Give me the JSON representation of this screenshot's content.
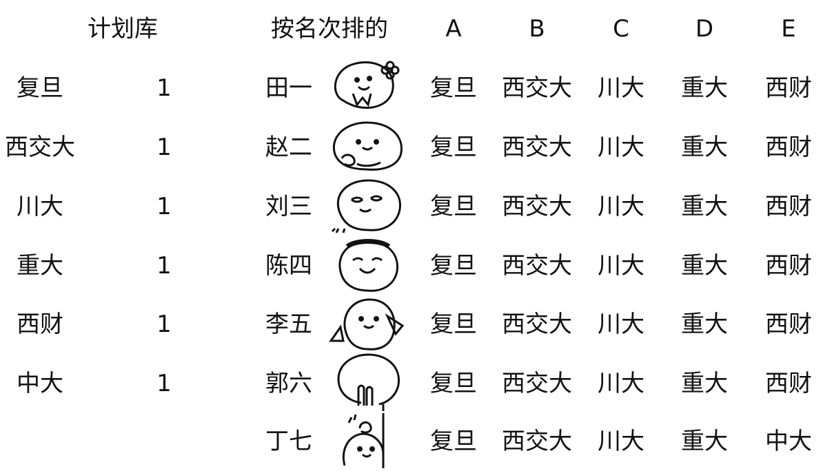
{
  "plan": {
    "header": "计划库",
    "schools": [
      "复旦",
      "西交大",
      "川大",
      "重大",
      "西财",
      "中大"
    ],
    "quotas": [
      "1",
      "1",
      "1",
      "1",
      "1",
      "1"
    ]
  },
  "ranking": {
    "header": "按名次排的",
    "choice_headers": [
      "A",
      "B",
      "C",
      "D",
      "E"
    ],
    "students": [
      {
        "name": "田一",
        "avatar": "smiley-flower-icon",
        "choices": [
          "复旦",
          "西交大",
          "川大",
          "重大",
          "西财"
        ]
      },
      {
        "name": "赵二",
        "avatar": "smiley-hands-icon",
        "choices": [
          "复旦",
          "西交大",
          "川大",
          "重大",
          "西财"
        ]
      },
      {
        "name": "刘三",
        "avatar": "smiley-smug-icon",
        "choices": [
          "复旦",
          "西交大",
          "川大",
          "重大",
          "西财"
        ]
      },
      {
        "name": "陈四",
        "avatar": "smiley-laughing-icon",
        "choices": [
          "复旦",
          "西交大",
          "川大",
          "重大",
          "西财"
        ]
      },
      {
        "name": "李五",
        "avatar": "smiley-waving-icon",
        "choices": [
          "复旦",
          "西交大",
          "川大",
          "重大",
          "西财"
        ]
      },
      {
        "name": "郭六",
        "avatar": "smiley-peace-icon",
        "choices": [
          "复旦",
          "西交大",
          "川大",
          "重大",
          "西财"
        ]
      },
      {
        "name": "丁七",
        "avatar": "smiley-peek-icon",
        "choices": [
          "复旦",
          "西交大",
          "川大",
          "重大",
          "中大"
        ]
      }
    ]
  }
}
